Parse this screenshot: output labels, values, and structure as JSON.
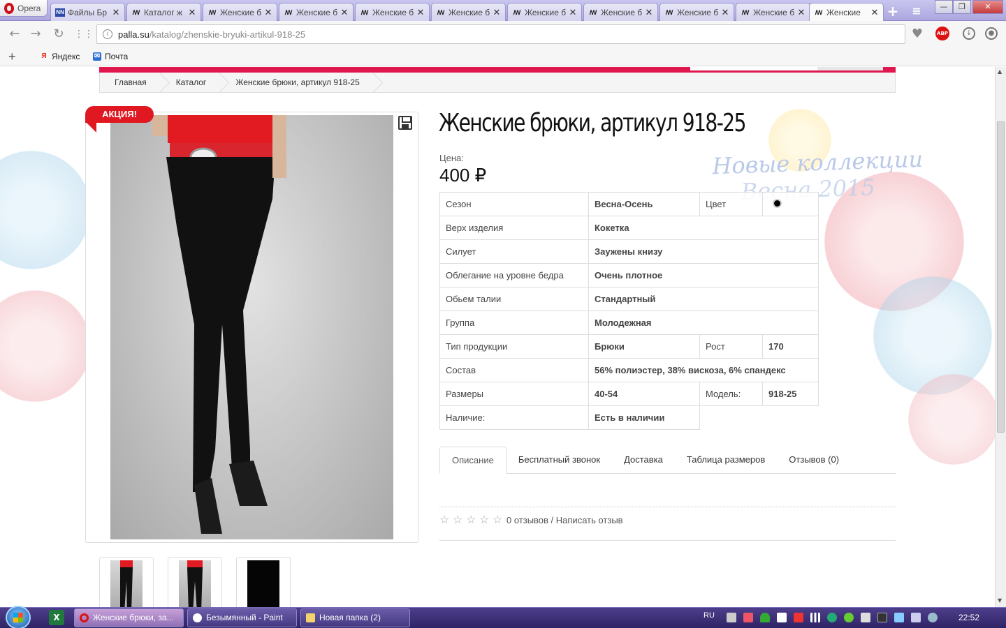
{
  "browser": {
    "opera_label": "Opera",
    "tabs": [
      {
        "title": "Файлы Бр",
        "icon": "nn-favicon"
      },
      {
        "title": "Каталог ж",
        "icon": "palla-favicon"
      },
      {
        "title": "Женские б",
        "icon": "palla-favicon"
      },
      {
        "title": "Женские б",
        "icon": "palla-favicon"
      },
      {
        "title": "Женские б",
        "icon": "palla-favicon"
      },
      {
        "title": "Женские б",
        "icon": "palla-favicon"
      },
      {
        "title": "Женские б",
        "icon": "palla-favicon"
      },
      {
        "title": "Женские б",
        "icon": "palla-favicon"
      },
      {
        "title": "Женские б",
        "icon": "palla-favicon"
      },
      {
        "title": "Женские б",
        "icon": "palla-favicon"
      },
      {
        "title": "Женские",
        "icon": "palla-favicon",
        "active": true
      }
    ],
    "url_domain": "palla.su",
    "url_path": "/katalog/zhenskie-bryuki-artikul-918-25",
    "bookmarks": [
      "Яндекс",
      "Почта"
    ],
    "abp_label": "ABP"
  },
  "page": {
    "breadcrumb": [
      "Главная",
      "Каталог",
      "Женские брюки, артикул 918-25"
    ],
    "promo_badge": "АКЦИЯ!",
    "watermark_line1": "Новые коллекции",
    "watermark_line2": "Весна 2015",
    "product_title": "Женские брюки, артикул 918-25",
    "price_label": "Цена:",
    "price": "400 ₽",
    "specs": {
      "season_label": "Сезон",
      "season": "Весна-Осень",
      "color_label": "Цвет",
      "color": "#000000",
      "top_label": "Верх изделия",
      "top": "Кокетка",
      "silhouette_label": "Силует",
      "silhouette": "Заужены книзу",
      "hip_label": "Облегание на уровне бедра",
      "hip": "Очень плотное",
      "waist_label": "Обьем талии",
      "waist": "Стандартный",
      "group_label": "Группа",
      "group": "Молодежная",
      "type_label": "Тип продукции",
      "type": "Брюки",
      "height_label": "Рост",
      "height": "170",
      "composition_label": "Состав",
      "composition": "56% полиэстер, 38% вискоза, 6% спандекс",
      "sizes_label": "Размеры",
      "sizes": "40-54",
      "model_label": "Модель:",
      "model": "918-25",
      "availability_label": "Наличие:",
      "availability": "Есть в наличии"
    },
    "tabs": [
      "Описание",
      "Бесплатный звонок",
      "Доставка",
      "Таблица размеров",
      "Отзывов (0)"
    ],
    "rating_stars": 0,
    "reviews_text": "0 отзывов / Написать отзыв"
  },
  "taskbar": {
    "items": [
      {
        "label": "Женские брюки, за..."
      },
      {
        "label": "Безымянный - Paint"
      },
      {
        "label": "Новая папка (2)"
      }
    ],
    "lang": "RU",
    "time": "22:52"
  },
  "colors": {
    "brand_pink": "#e0164f",
    "promo_red": "#e01822",
    "tab_strip": "#aba7de",
    "taskbar": "#2f2466"
  }
}
